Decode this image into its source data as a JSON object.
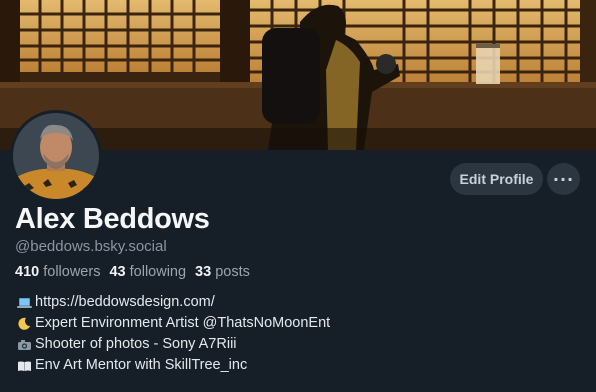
{
  "profile": {
    "display_name": "Alex Beddows",
    "handle": "@beddows.bsky.social",
    "followers_count": "410",
    "followers_label": "followers",
    "following_count": "43",
    "following_label": "following",
    "posts_count": "33",
    "posts_label": "posts"
  },
  "actions": {
    "edit_profile": "Edit Profile",
    "more": "···"
  },
  "bio": [
    {
      "icon": "laptop-icon",
      "text": "https://beddowsdesign.com/"
    },
    {
      "icon": "crescent-moon-icon",
      "text": "Expert Environment Artist @ThatsNoMoonEnt"
    },
    {
      "icon": "camera-icon",
      "text": "Shooter of photos - Sony A7Riii"
    },
    {
      "icon": "book-icon",
      "text": "Env Art Mentor with SkillTree_inc"
    }
  ],
  "colors": {
    "background": "#161e27",
    "button_bg": "#2c3640",
    "muted_text": "#8a96a3"
  }
}
